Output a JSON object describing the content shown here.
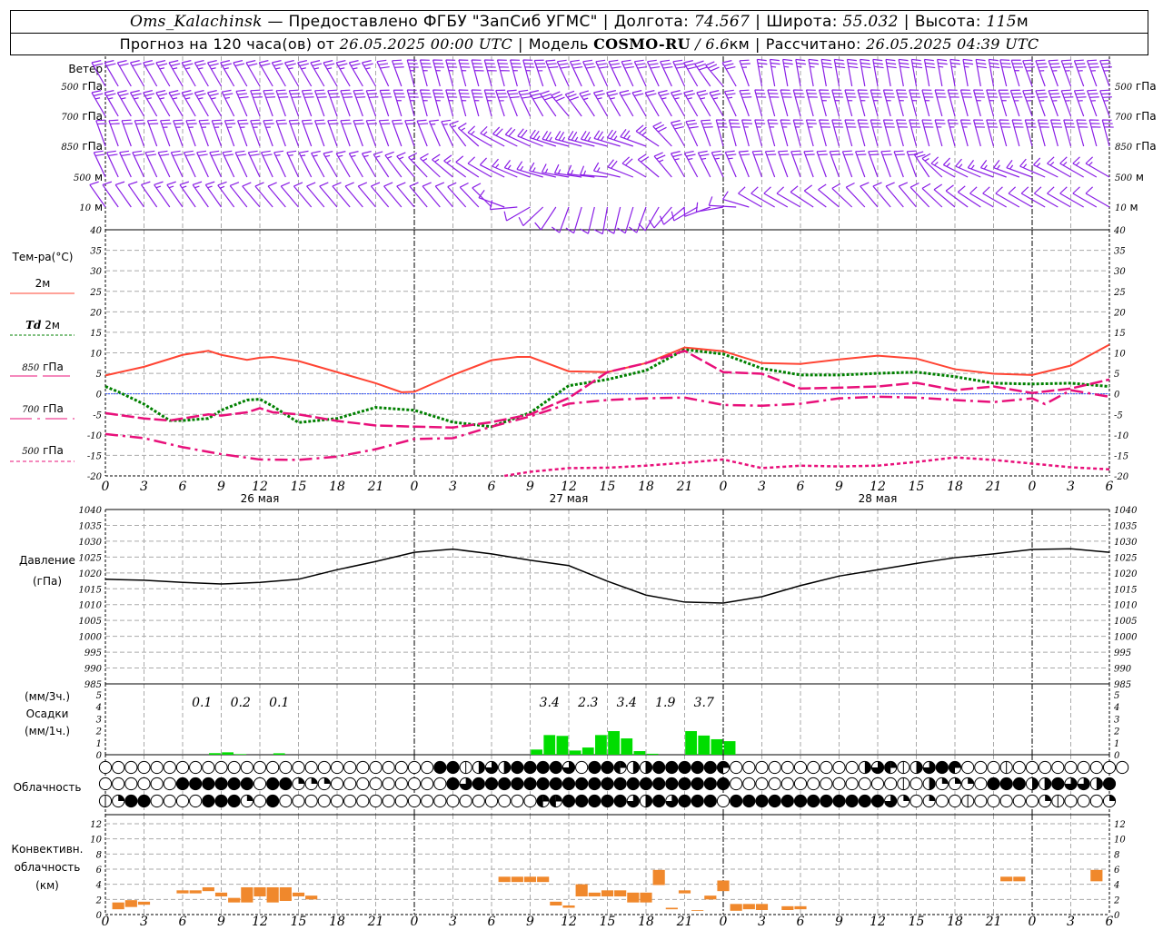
{
  "header": {
    "station": "Oms_Kalachinsk",
    "provider": " — Предоставлено ФГБУ \"ЗапСиб УГМС\"",
    "sep": "|",
    "lon_label": "Долгота: ",
    "lon": "74.567",
    "lat_label": "Широта: ",
    "lat": "55.032",
    "alt_label": "Высота: ",
    "alt": "115",
    "alt_unit": "м",
    "forecast_label": "Прогноз на 120 часа(ов) от ",
    "forecast_start": "26.05.2025 00:00 UTC",
    "model_label": "Модель ",
    "model": "COSMO-RU",
    "model_sep": " / ",
    "resolution": "6.6",
    "resolution_unit": "км",
    "computed_label": "Рассчитано: ",
    "computed": "26.05.2025 04:39 UTC"
  },
  "colors": {
    "wind": "#8a1ee6",
    "t2m": "#ff4433",
    "td2m": "#008000",
    "upper": "#e8107a",
    "zero_line": "#3050ff",
    "precip": "#00dd00",
    "convective": "#f0882c",
    "grid": "#aaaaaa"
  },
  "axis": {
    "hour_ticks": [
      "0",
      "3",
      "6",
      "9",
      "12",
      "15",
      "18",
      "21",
      "0",
      "3",
      "6",
      "9",
      "12",
      "15",
      "18",
      "21",
      "0",
      "3",
      "6",
      "9",
      "12",
      "15",
      "18",
      "21",
      "0",
      "3",
      "6"
    ],
    "dates": [
      {
        "h": 12,
        "label": "26 мая"
      },
      {
        "h": 36,
        "label": "27 мая"
      },
      {
        "h": 60,
        "label": "28 мая"
      }
    ],
    "day_boundaries": [
      24,
      48,
      72
    ],
    "hours_range": [
      0,
      78
    ]
  },
  "wind": {
    "title": "Ветер",
    "levels": [
      {
        "label_num": "500",
        "label_unit": " гПа",
        "dir": [
          330,
          330,
          330,
          330,
          330,
          330,
          330,
          330,
          345,
          345,
          345,
          345,
          335,
          335,
          335,
          335,
          320,
          350,
          350,
          350,
          350,
          350,
          350,
          350,
          340,
          340,
          340
        ],
        "speed": [
          20,
          20,
          25,
          25,
          20,
          25,
          25,
          25,
          35,
          35,
          40,
          35,
          30,
          30,
          30,
          30,
          30,
          25,
          25,
          30,
          30,
          30,
          25,
          30,
          35,
          35,
          35
        ]
      },
      {
        "label_num": "700",
        "label_unit": " гПа",
        "dir": [
          330,
          330,
          330,
          330,
          340,
          340,
          340,
          340,
          345,
          345,
          345,
          335,
          320,
          330,
          330,
          330,
          330,
          345,
          345,
          345,
          345,
          345,
          345,
          345,
          340,
          340,
          340
        ],
        "speed": [
          25,
          25,
          25,
          25,
          30,
          30,
          30,
          30,
          35,
          35,
          35,
          30,
          30,
          25,
          20,
          25,
          25,
          30,
          30,
          35,
          35,
          35,
          30,
          35,
          35,
          35,
          35
        ]
      },
      {
        "label_num": "850",
        "label_unit": " гПа",
        "dir": [
          340,
          340,
          340,
          340,
          340,
          340,
          340,
          340,
          340,
          335,
          300,
          295,
          285,
          285,
          290,
          330,
          345,
          345,
          345,
          345,
          345,
          345,
          345,
          345,
          345,
          345,
          345
        ],
        "speed": [
          20,
          20,
          25,
          25,
          25,
          20,
          20,
          20,
          20,
          15,
          15,
          20,
          25,
          25,
          25,
          30,
          30,
          25,
          25,
          30,
          30,
          30,
          25,
          30,
          30,
          30,
          30
        ]
      },
      {
        "label_num": "500",
        "label_unit": " м",
        "dir": [
          335,
          335,
          335,
          335,
          335,
          335,
          330,
          330,
          320,
          310,
          300,
          290,
          280,
          275,
          300,
          330,
          335,
          340,
          340,
          340,
          340,
          340,
          300,
          290,
          290,
          300,
          300
        ],
        "speed": [
          20,
          20,
          20,
          20,
          20,
          15,
          15,
          15,
          15,
          15,
          10,
          15,
          15,
          15,
          20,
          25,
          25,
          20,
          20,
          20,
          20,
          20,
          15,
          15,
          15,
          15,
          15
        ]
      },
      {
        "label_num": "10",
        "label_unit": " м",
        "dir": [
          325,
          325,
          325,
          325,
          320,
          320,
          320,
          320,
          320,
          320,
          315,
          240,
          200,
          190,
          200,
          230,
          260,
          300,
          300,
          310,
          320,
          320,
          310,
          300,
          300,
          300,
          300
        ],
        "speed": [
          10,
          10,
          15,
          15,
          10,
          10,
          10,
          10,
          10,
          10,
          10,
          10,
          10,
          10,
          10,
          10,
          10,
          10,
          10,
          10,
          10,
          10,
          10,
          10,
          10,
          10,
          10
        ]
      }
    ]
  },
  "legend": {
    "temp_title": "Тем-ра(°C)",
    "t2m": "2м",
    "td_sym": "Td",
    "td_lvl": "2м",
    "p850_num": "850",
    "p850_unit": "гПа",
    "p700_num": "700",
    "p700_unit": "гПа",
    "p500_num": "500",
    "p500_unit": "гПа",
    "pressure_1": "Давление",
    "pressure_2": "(гПа)",
    "precip_1": "(мм/3ч.)",
    "precip_2": "Осадки",
    "precip_3": "(мм/1ч.)",
    "clouds": "Облачность",
    "conv_1": "Конвективн.",
    "conv_2": "облачность",
    "conv_3": "(км)"
  },
  "chart_data": [
    {
      "type": "line",
      "ylabel": "Тем-ра(°C)",
      "ylim": [
        -20,
        40
      ],
      "yticks": [
        "40",
        "35",
        "30",
        "25",
        "20",
        "15",
        "10",
        "5",
        "0",
        "-5",
        "-10",
        "-15",
        "-20"
      ],
      "grid": true,
      "series": [
        {
          "name": "2м",
          "style": "solid",
          "x": [
            0,
            3,
            6,
            8,
            9,
            11,
            12,
            13,
            15,
            18,
            21,
            23,
            24,
            27,
            30,
            32,
            33,
            36,
            39,
            42,
            44,
            45,
            48,
            51,
            54,
            57,
            60,
            63,
            66,
            69,
            72,
            75,
            78
          ],
          "y": [
            4.5,
            6.6,
            9.5,
            10.5,
            9.5,
            8.3,
            8.8,
            9,
            8,
            5.3,
            2.6,
            0.4,
            0.5,
            4.6,
            8.2,
            9,
            9,
            5.5,
            5.3,
            7.5,
            10,
            11.3,
            10.4,
            7.5,
            7.3,
            8.4,
            9.3,
            8.6,
            6,
            4.9,
            4.6,
            6.9,
            12
          ]
        },
        {
          "name": "Td 2м",
          "style": "dotted",
          "x": [
            0,
            1,
            3,
            5,
            6,
            8,
            9,
            11,
            12,
            13,
            15,
            18,
            21,
            24,
            27,
            30,
            33,
            36,
            39,
            42,
            45,
            48,
            51,
            54,
            57,
            60,
            63,
            66,
            69,
            72,
            75,
            78
          ],
          "y": [
            1.8,
            0.5,
            -2.5,
            -6.5,
            -6.5,
            -6,
            -4,
            -1.5,
            -1.3,
            -3,
            -7,
            -6,
            -3.3,
            -4,
            -6.9,
            -8,
            -4.6,
            2,
            3.5,
            5.7,
            10.8,
            9.7,
            6.2,
            4.6,
            4.6,
            5,
            5.3,
            4.2,
            2.6,
            2.4,
            2.6,
            1.8
          ]
        },
        {
          "name": "850 гПа",
          "style": "long-dash",
          "x": [
            0,
            3,
            5,
            6,
            8,
            9,
            11,
            12,
            13,
            15,
            18,
            21,
            24,
            27,
            30,
            33,
            36,
            39,
            42,
            45,
            48,
            51,
            54,
            57,
            60,
            63,
            66,
            69,
            72,
            75,
            78
          ],
          "y": [
            -4.7,
            -6,
            -6.5,
            -6,
            -5,
            -5.3,
            -4.5,
            -3.5,
            -4.5,
            -5,
            -6.6,
            -7.7,
            -8,
            -8.2,
            -6.9,
            -5,
            -1,
            5.3,
            7.5,
            10.5,
            5.3,
            4.9,
            1.3,
            1.5,
            1.8,
            2.7,
            0.9,
            1.8,
            0.2,
            1.3,
            3.5
          ]
        },
        {
          "name": "700 гПа",
          "style": "dash-dot",
          "x": [
            0,
            3,
            6,
            9,
            12,
            15,
            18,
            21,
            24,
            27,
            30,
            33,
            36,
            39,
            42,
            45,
            48,
            51,
            54,
            57,
            60,
            63,
            66,
            69,
            72,
            73,
            75,
            78
          ],
          "y": [
            -9.8,
            -10.8,
            -13,
            -14.7,
            -16,
            -16.1,
            -15.3,
            -13.5,
            -11,
            -10.8,
            -8,
            -5.5,
            -2.4,
            -1.5,
            -1.1,
            -0.9,
            -2.7,
            -2.9,
            -2.4,
            -1.1,
            -0.7,
            -0.9,
            -1.5,
            -2,
            -1.1,
            -2.5,
            0.9,
            -0.7
          ]
        },
        {
          "name": "500 гПа",
          "style": "short-dash",
          "x": [
            31,
            33,
            36,
            39,
            42,
            45,
            48,
            51,
            54,
            57,
            60,
            63,
            66,
            69,
            72,
            75,
            78
          ],
          "y": [
            -20,
            -19,
            -18.1,
            -18,
            -17.5,
            -16.8,
            -16,
            -18.1,
            -17.5,
            -17.7,
            -17.5,
            -16.6,
            -15.5,
            -16.1,
            -17,
            -17.9,
            -18.4
          ]
        }
      ]
    },
    {
      "type": "line",
      "ylabel": "Давление (гПа)",
      "ylim": [
        985,
        1040
      ],
      "yticks": [
        "1040",
        "1035",
        "1030",
        "1025",
        "1020",
        "1015",
        "1010",
        "1005",
        "1000",
        "995",
        "990",
        "985"
      ],
      "grid": true,
      "x": [
        0,
        3,
        6,
        9,
        12,
        15,
        18,
        21,
        24,
        27,
        30,
        33,
        36,
        39,
        42,
        45,
        48,
        51,
        54,
        57,
        60,
        63,
        66,
        69,
        72,
        75,
        78
      ],
      "y": [
        1018,
        1017.7,
        1017,
        1016.5,
        1017,
        1018,
        1021,
        1023.6,
        1026.5,
        1027.5,
        1026,
        1024,
        1022.3,
        1017.4,
        1013,
        1010.8,
        1010.5,
        1012.5,
        1016,
        1019,
        1021,
        1023,
        1024.8,
        1026,
        1027.4,
        1027.6,
        1026.5
      ]
    },
    {
      "type": "bar",
      "ylabel": "Осадки (мм/1ч.)",
      "ylim": [
        0,
        5
      ],
      "yticks": [
        "5",
        "4",
        "3",
        "2",
        "1",
        "0"
      ],
      "hourly": [
        {
          "h": 9,
          "mm": 0.13
        },
        {
          "h": 10,
          "mm": 0.2
        },
        {
          "h": 11,
          "mm": 0.05
        },
        {
          "h": 14,
          "mm": 0.12
        },
        {
          "h": 34,
          "mm": 0.43
        },
        {
          "h": 35,
          "mm": 1.64
        },
        {
          "h": 36,
          "mm": 1.57
        },
        {
          "h": 37,
          "mm": 0.35
        },
        {
          "h": 38,
          "mm": 0.6
        },
        {
          "h": 39,
          "mm": 1.64
        },
        {
          "h": 40,
          "mm": 1.97
        },
        {
          "h": 41,
          "mm": 1.36
        },
        {
          "h": 42,
          "mm": 0.3
        },
        {
          "h": 43,
          "mm": 0.08
        },
        {
          "h": 46,
          "mm": 1.97
        },
        {
          "h": 47,
          "mm": 1.6
        },
        {
          "h": 48,
          "mm": 1.29
        },
        {
          "h": 49,
          "mm": 1.13
        }
      ],
      "sum3h_labels": [
        {
          "h": 7.5,
          "label": "0.1"
        },
        {
          "h": 10.5,
          "label": "0.2"
        },
        {
          "h": 13.5,
          "label": "0.1"
        },
        {
          "h": 34.5,
          "label": "3.4"
        },
        {
          "h": 37.5,
          "label": "2.3"
        },
        {
          "h": 40.5,
          "label": "3.4"
        },
        {
          "h": 43.5,
          "label": "1.9"
        },
        {
          "h": 46.5,
          "label": "3.7"
        }
      ]
    },
    {
      "type": "table",
      "ylabel": "Облачность",
      "encoding": "hourly cloud cover in octas per row (0..8)",
      "rows": [
        "00000000000000000000000000881465888860883458888830000000000463146830001000000000",
        "0000008888880882220000000008688888888888888888888000000000000010422208884586648",
        "1288000088820800000000000000000000338888865868880888888888888620200100000210002"
      ]
    },
    {
      "type": "bar",
      "ylabel": "Конвективн. облачность (км)",
      "ylim": [
        0,
        13
      ],
      "yticks": [
        "12",
        "10",
        "8",
        "6",
        "4",
        "2",
        "0"
      ],
      "grid": true,
      "bars": [
        {
          "h": 1,
          "base": 0.7,
          "top": 1.6
        },
        {
          "h": 2,
          "base": 1.0,
          "top": 1.9
        },
        {
          "h": 3,
          "base": 1.3,
          "top": 1.7
        },
        {
          "h": 6,
          "base": 2.8,
          "top": 3.2
        },
        {
          "h": 7,
          "base": 2.8,
          "top": 3.2
        },
        {
          "h": 8,
          "base": 3.1,
          "top": 3.6
        },
        {
          "h": 9,
          "base": 2.4,
          "top": 2.9
        },
        {
          "h": 10,
          "base": 1.6,
          "top": 2.2
        },
        {
          "h": 11,
          "base": 1.6,
          "top": 3.6
        },
        {
          "h": 12,
          "base": 2.4,
          "top": 3.6
        },
        {
          "h": 13,
          "base": 1.6,
          "top": 3.6
        },
        {
          "h": 14,
          "base": 1.8,
          "top": 3.6
        },
        {
          "h": 15,
          "base": 2.4,
          "top": 2.9
        },
        {
          "h": 16,
          "base": 2.0,
          "top": 2.5
        },
        {
          "h": 31,
          "base": 4.3,
          "top": 5.0
        },
        {
          "h": 32,
          "base": 4.3,
          "top": 5.0
        },
        {
          "h": 33,
          "base": 4.3,
          "top": 5.0
        },
        {
          "h": 34,
          "base": 4.3,
          "top": 5.0
        },
        {
          "h": 35,
          "base": 1.2,
          "top": 1.7
        },
        {
          "h": 36,
          "base": 0.9,
          "top": 1.2
        },
        {
          "h": 37,
          "base": 2.4,
          "top": 4.0
        },
        {
          "h": 38,
          "base": 2.4,
          "top": 2.9
        },
        {
          "h": 39,
          "base": 2.4,
          "top": 3.2
        },
        {
          "h": 40,
          "base": 2.4,
          "top": 3.2
        },
        {
          "h": 41,
          "base": 1.6,
          "top": 2.9
        },
        {
          "h": 42,
          "base": 1.6,
          "top": 2.9
        },
        {
          "h": 43,
          "base": 3.9,
          "top": 5.9
        },
        {
          "h": 44,
          "base": 0.7,
          "top": 0.9
        },
        {
          "h": 45,
          "base": 2.8,
          "top": 3.2
        },
        {
          "h": 46,
          "base": 0.5,
          "top": 0.6
        },
        {
          "h": 47,
          "base": 2.0,
          "top": 2.5
        },
        {
          "h": 48,
          "base": 3.1,
          "top": 4.5
        },
        {
          "h": 49,
          "base": 0.5,
          "top": 1.4
        },
        {
          "h": 50,
          "base": 0.7,
          "top": 1.4
        },
        {
          "h": 51,
          "base": 0.6,
          "top": 1.4
        },
        {
          "h": 53,
          "base": 0.6,
          "top": 1.1
        },
        {
          "h": 54,
          "base": 0.7,
          "top": 1.1
        },
        {
          "h": 70,
          "base": 4.4,
          "top": 5.0
        },
        {
          "h": 71,
          "base": 4.4,
          "top": 5.0
        },
        {
          "h": 77,
          "base": 4.4,
          "top": 5.9
        }
      ]
    }
  ]
}
